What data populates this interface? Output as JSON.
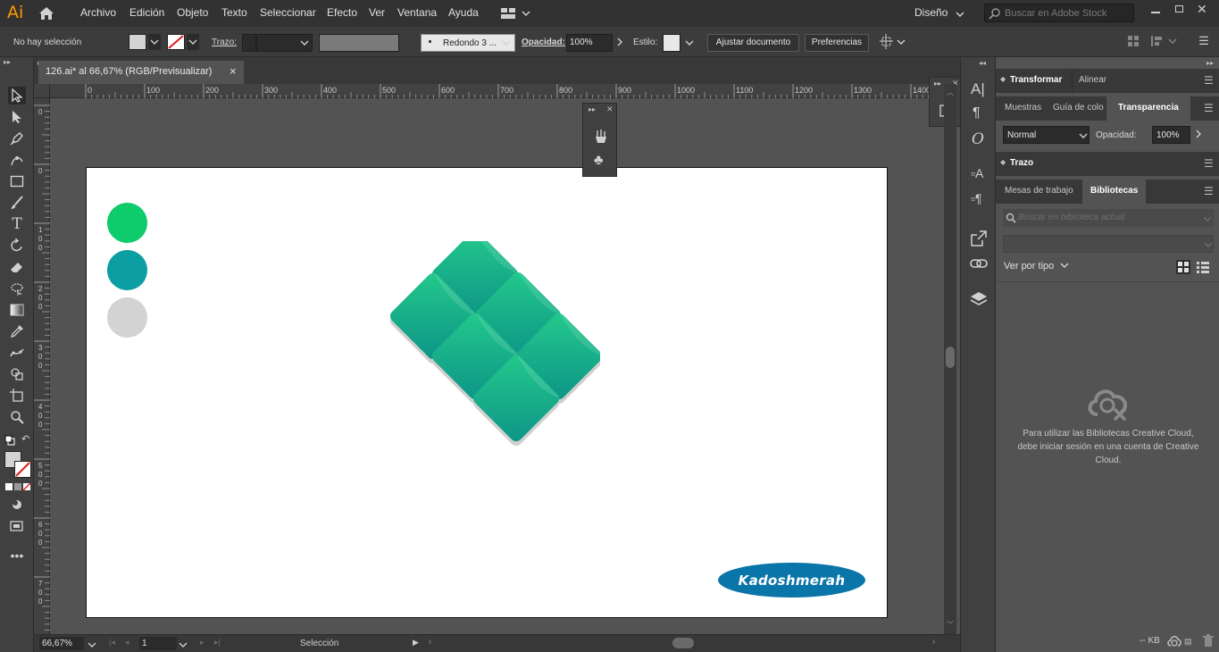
{
  "menubar": {
    "logo": "Ai",
    "items": [
      "Archivo",
      "Edición",
      "Objeto",
      "Texto",
      "Seleccionar",
      "Efecto",
      "Ver",
      "Ventana",
      "Ayuda"
    ],
    "workspace": "Diseño",
    "search_placeholder": "Buscar en Adobe Stock"
  },
  "control": {
    "selection": "No hay selección",
    "stroke_label": "Trazo:",
    "brush": "Redondo 3 ...",
    "opacity_label": "Opacidad:",
    "opacity_value": "100%",
    "style_label": "Estilo:",
    "fit_button": "Ajustar documento",
    "prefs_button": "Preferencias"
  },
  "document": {
    "tab_title": "126.ai* al 66,67% (RGB/Previsualizar)",
    "close": "×"
  },
  "ruler": {
    "h_ticks": [
      "0",
      "100",
      "200",
      "300",
      "400",
      "500",
      "600",
      "700",
      "800",
      "900",
      "1000",
      "1100",
      "1200",
      "1300",
      "1400"
    ],
    "v_ticks": [
      "0",
      "0",
      "1\n0\n0",
      "2\n0\n0",
      "3\n0\n0",
      "4\n0\n0",
      "5\n0\n0",
      "6\n0\n0",
      "7\n0\n0"
    ]
  },
  "artwork": {
    "swatch_colors": [
      "#0ecb6c",
      "#0b9fa3",
      "#d3d3d3"
    ],
    "tile_gradient": [
      "#21c487",
      "#0f9b8a"
    ],
    "logo_text": "Kadoshmerah",
    "logo_color": "#0a75a8"
  },
  "status": {
    "zoom": "66,67%",
    "page": "1",
    "mode": "Selección"
  },
  "panels": {
    "group1_tabs": [
      "Transformar",
      "Alinear"
    ],
    "group2_tabs": [
      "Muestras",
      "Guía de colo",
      "Transparencia"
    ],
    "blend_mode": "Normal",
    "opacity_label": "Opacidad:",
    "opacity_value": "100%",
    "group3_tabs": [
      "Trazo"
    ],
    "group4_tabs": [
      "Mesas de trabajo",
      "Bibliotecas"
    ],
    "lib_search_placeholder": "Buscar en biblioteca actual",
    "view_by": "Ver por tipo",
    "cc_message": "Para utilizar las Bibliotecas Creative Cloud, debe iniciar sesión en una cuenta de Creative Cloud.",
    "kb": "-- KB"
  }
}
